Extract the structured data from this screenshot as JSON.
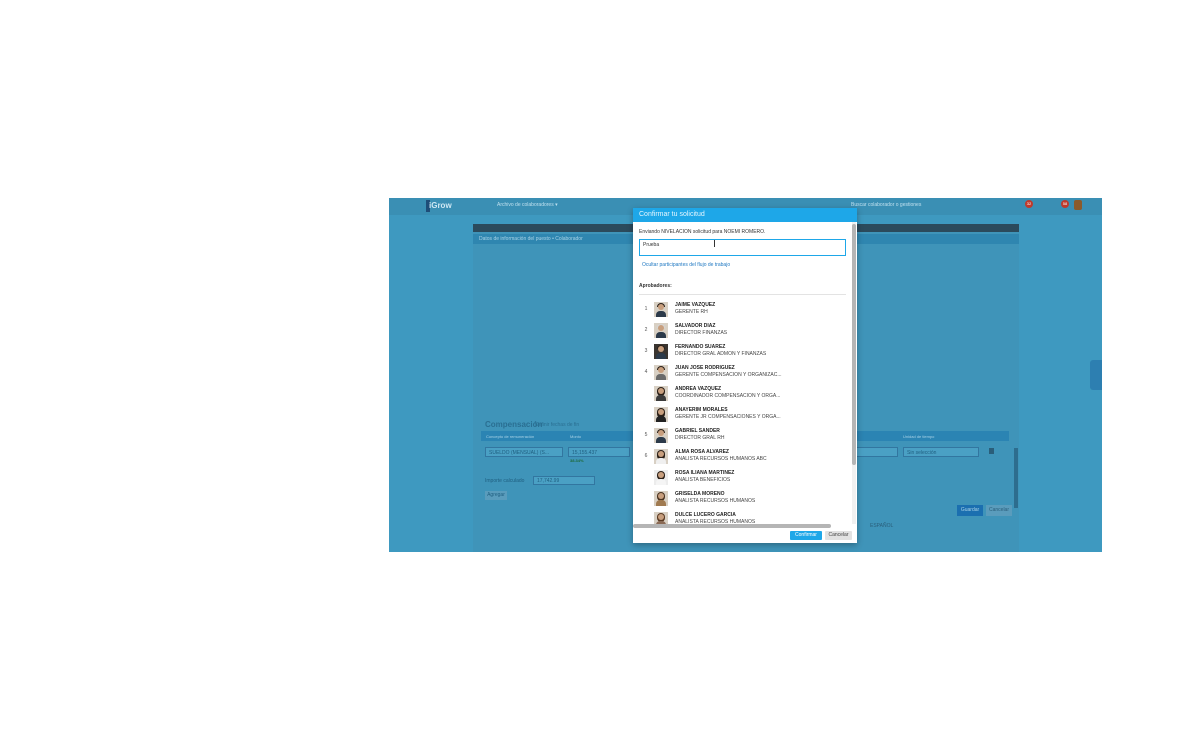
{
  "app": {
    "logo": "iGrow",
    "menu": "Archivo de colaboradores ▾",
    "search": "Buscar colaborador o gestiones"
  },
  "background": {
    "header_text": "Datos de información del puesto • Colaborador",
    "compensation_title": "Compensación",
    "compensation_sub": "Definir fechas de fin",
    "columns": [
      "Concepto de remuneración",
      "Monto",
      "Unidad de tiempo"
    ],
    "concept_value": "SUELDO (MENSUAL) (S...",
    "amount_value": "15,155.437",
    "percent_value": "38.34%",
    "unit_value": "Sin selección",
    "calc_label": "Importe calculado",
    "calc_value": "17,742.99",
    "add_button": "Agregar",
    "save_button": "Guardar",
    "cancel_button": "Cancelar",
    "language": "ESPAÑOL",
    "notif_1": "32",
    "notif_2": "58"
  },
  "modal": {
    "title": "Confirmar tu solicitud",
    "sending_text": "Enviando NIVELACION solicitud para NOEMI ROMERO.",
    "comment_value": "Prueba",
    "toggle_link": "Ocultar participantes del flujo de trabajo",
    "approvers_title": "Aprobadores:",
    "approvers": [
      {
        "num": "1",
        "name": "JAIME VAZQUEZ",
        "role": "GERENTE RH",
        "gender": "m"
      },
      {
        "num": "2",
        "name": "SALVADOR DIAZ",
        "role": "DIRECTOR FINANZAS",
        "gender": "m"
      },
      {
        "num": "3",
        "name": "FERNANDO SUAREZ",
        "role": "DIRECTOR GRAL ADMON Y FINANZAS",
        "gender": "m"
      },
      {
        "num": "4",
        "name": "JUAN JOSE RODRIGUEZ",
        "role": "GERENTE COMPENSACION Y ORGANIZAC...",
        "gender": "m"
      },
      {
        "num": "",
        "name": "ANDREA VAZQUEZ",
        "role": "COORDINADOR COMPENSACION Y ORGA...",
        "gender": "f"
      },
      {
        "num": "",
        "name": "ANAYERIM MORALES",
        "role": "GERENTE JR COMPENSACIONES Y ORGA...",
        "gender": "f"
      },
      {
        "num": "5",
        "name": "GABRIEL SANDER",
        "role": "DIRECTOR GRAL RH",
        "gender": "m"
      },
      {
        "num": "6",
        "name": "ALMA ROSA ALVAREZ",
        "role": "ANALISTA RECURSOS HUMANOS ABC",
        "gender": "f"
      },
      {
        "num": "",
        "name": "ROSA ILIANA MARTINEZ",
        "role": "ANALISTA BENEFICIOS",
        "gender": "f"
      },
      {
        "num": "",
        "name": "GRISELDA MORENO",
        "role": "ANALISTA RECURSOS HUMANOS",
        "gender": "f"
      },
      {
        "num": "",
        "name": "DULCE LUCERO GARCIA",
        "role": "ANALISTA RECURSOS HUMANOS",
        "gender": "f"
      }
    ],
    "confirm_button": "Confirmar",
    "cancel_button": "Cancelar"
  }
}
